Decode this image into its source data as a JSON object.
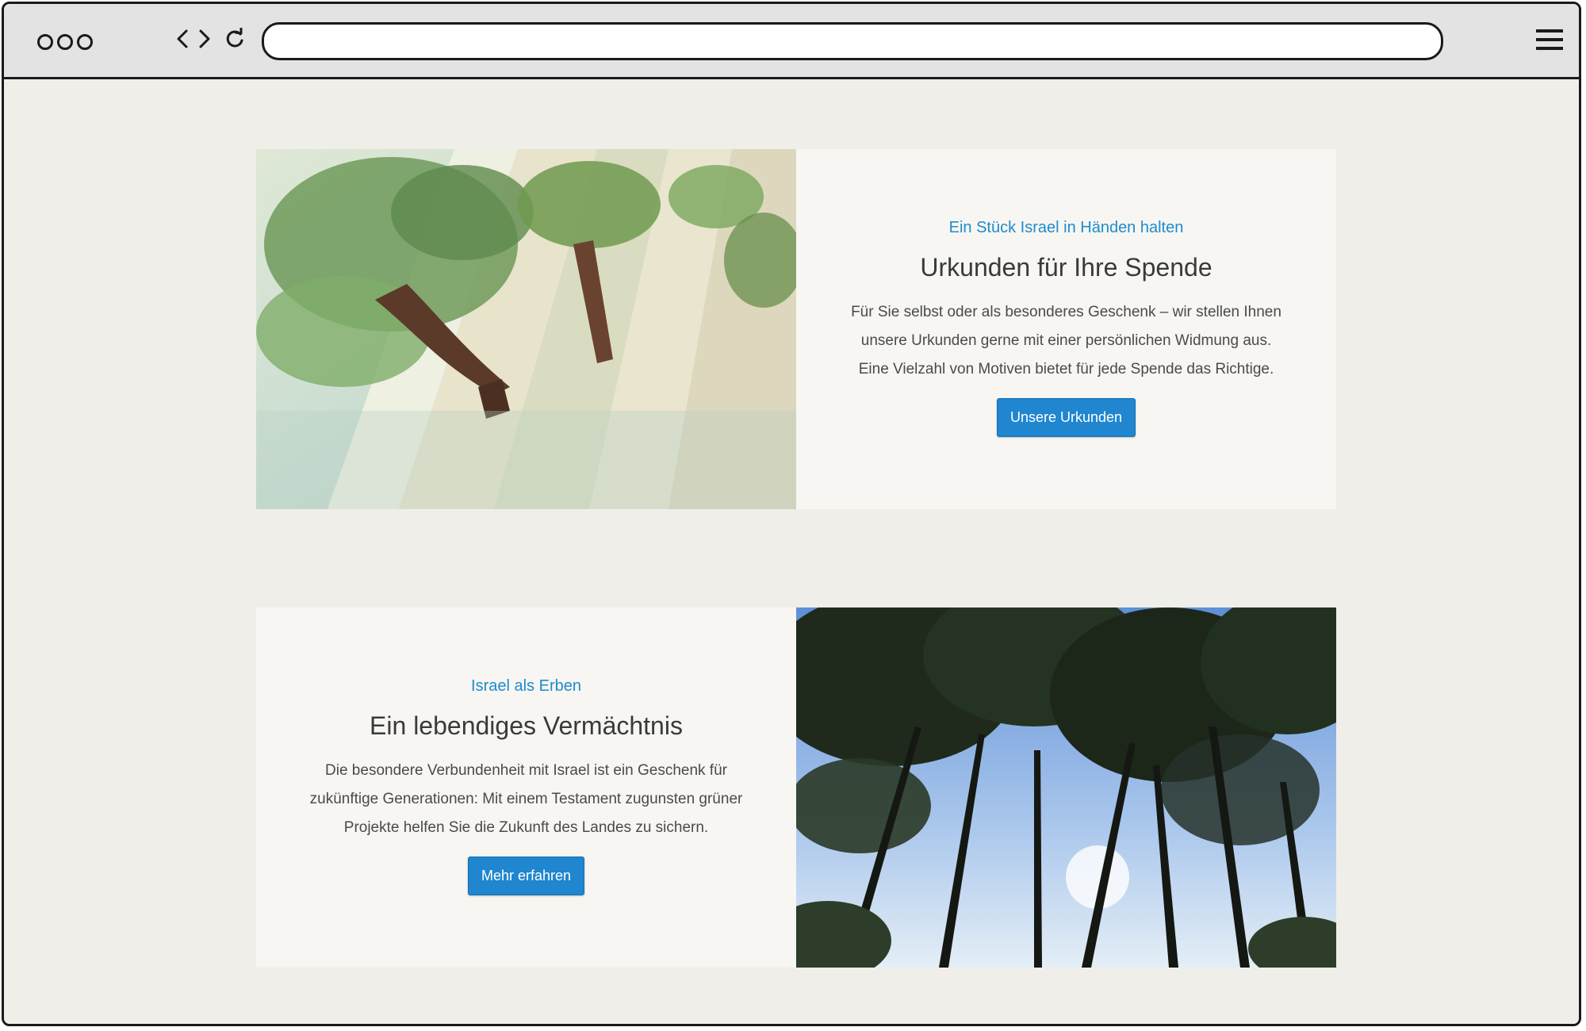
{
  "browser": {
    "url_value": "",
    "icons": [
      "window-dot-icon",
      "back-icon",
      "forward-icon",
      "reload-icon",
      "hamburger-menu-icon"
    ]
  },
  "sections": [
    {
      "eyebrow": "Ein Stück Israel in Händen halten",
      "heading": "Urkunden für Ihre Spende",
      "text": "Für Sie selbst oder als besonderes Geschenk – wir stellen Ihnen unsere Urkunden gerne mit einer persönlichen Widmung aus. Eine Vielzahl von Motiven bietet für jede Spende das Richtige.",
      "button": "Unsere Urkunden",
      "image": "watercolor-tree-certificates-image"
    },
    {
      "eyebrow": "Israel als Erben",
      "heading": "Ein lebendiges Vermächtnis",
      "text": "Die besondere Verbundenheit mit Israel ist ein Geschenk für zukünftige Generationen: Mit einem Testament zugunsten grüner Projekte helfen Sie die Zukunft des Landes zu sichern.",
      "button": "Mehr erfahren",
      "image": "forest-canopy-photo"
    }
  ],
  "colors": {
    "accent": "#1e8ccc",
    "button": "#1f86cf",
    "page_bg": "#f0eee8",
    "panel_bg": "#f7f6f2"
  }
}
